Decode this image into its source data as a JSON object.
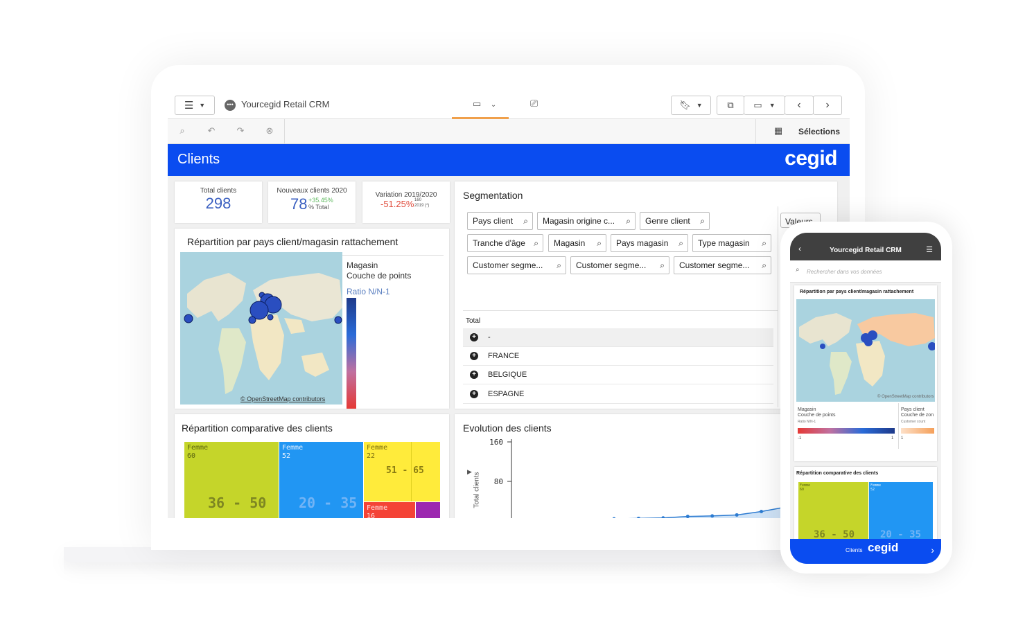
{
  "app": {
    "title": "Yourcegid Retail CRM",
    "selections_label": "Sélections",
    "page_title": "Clients",
    "brand": "cegid"
  },
  "kpis": [
    {
      "label": "Total clients",
      "value": "298"
    },
    {
      "label": "Nouveaux clients 2020",
      "value": "78",
      "delta": "+35.45%",
      "sub": "% Total"
    },
    {
      "label": "Variation 2019/2020",
      "value": "-51.25%",
      "sup": "160",
      "sub": "2019 (*)"
    }
  ],
  "map_card": {
    "title": "Répartition par pays client/magasin rattachement",
    "legend_layer": "Magasin",
    "legend_sublayer": "Couche de points",
    "legend_measure": "Ratio N/N-1",
    "attribution": "© OpenStreetMap contributors"
  },
  "segmentation": {
    "title": "Segmentation",
    "values_button": "Valeurs",
    "filters": [
      "Pays client",
      "Magasin origine c...",
      "Genre client",
      "Tranche d'âge",
      "Magasin",
      "Pays magasin",
      "Type magasin",
      "Customer segme...",
      "Customer segme...",
      "Customer segme..."
    ],
    "total_label": "Total",
    "rows": [
      "-",
      "FRANCE",
      "BELGIQUE",
      "ESPAGNE"
    ]
  },
  "treemap_card": {
    "title": "Répartition comparative des clients",
    "cells": [
      {
        "label": "Femme",
        "count": "60",
        "group": "36 - 50",
        "color": "#c5d52a"
      },
      {
        "label": "Femme",
        "count": "52",
        "group": "20 - 35",
        "color": "#2196f3"
      },
      {
        "label": "Femme",
        "count": "22",
        "group": "51 - 65",
        "color": "#ffeb3b"
      },
      {
        "label": "Femme",
        "count": "16",
        "group": "",
        "color": "#f44336"
      }
    ]
  },
  "evolution_card": {
    "title": "Evolution des clients",
    "ylabel": "Total clients",
    "ticks": [
      "160",
      "80"
    ]
  },
  "chart_data": {
    "type": "line",
    "title": "Evolution des clients",
    "ylabel": "Total clients",
    "yticks": [
      80,
      160
    ],
    "ylim": [
      0,
      160
    ],
    "values": [
      4,
      5,
      6,
      9,
      10,
      12,
      19,
      28
    ]
  },
  "phone": {
    "title": "Yourcegid Retail CRM",
    "search_placeholder": "Rechercher dans vos données",
    "map_title": "Répartition par pays client/magasin rattachement",
    "attribution": "© OpenStreetMap contributors",
    "legend1_layer": "Magasin",
    "legend1_sub": "Couche de points",
    "legend1_measure": "Ratio N/N-1",
    "legend1_min": "-1",
    "legend1_max": "1",
    "legend2_layer": "Pays client",
    "legend2_sub": "Couche de zon",
    "legend2_measure": "Customer count",
    "legend2_min": "1",
    "treemap_title": "Répartition comparative des clients",
    "cells": [
      {
        "label": "Femme",
        "count": "60",
        "group": "36 - 50"
      },
      {
        "label": "Femme",
        "count": "52",
        "group": "20 - 35"
      }
    ],
    "footer_label": "Clients",
    "footer_brand": "cegid"
  }
}
